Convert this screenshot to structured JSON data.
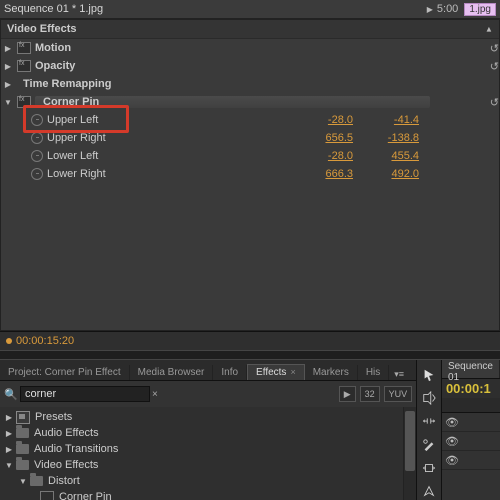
{
  "header": {
    "sequence_title": "Sequence 01 * 1.jpg",
    "duration": "5:00",
    "clip_tag": "1.jpg"
  },
  "fx": {
    "heading": "Video Effects",
    "motion": "Motion",
    "opacity": "Opacity",
    "time_remap": "Time Remapping",
    "corner_pin": "Corner Pin",
    "props": [
      {
        "name": "Upper Left",
        "x": "-28.0",
        "y": "-41.4"
      },
      {
        "name": "Upper Right",
        "x": "656.5",
        "y": "-138.8"
      },
      {
        "name": "Lower Left",
        "x": "-28.0",
        "y": "455.4"
      },
      {
        "name": "Lower Right",
        "x": "666.3",
        "y": "492.0"
      }
    ]
  },
  "current_time": "00:00:15:20",
  "project": {
    "tabs": [
      "Project: Corner Pin Effect",
      "Media Browser",
      "Info",
      "Effects",
      "Markers",
      "His"
    ],
    "active_tab": 3,
    "search_value": "corner",
    "type_badge_a": "32",
    "type_badge_b": "YUV",
    "tree": {
      "presets": "Presets",
      "audio_effects": "Audio Effects",
      "audio_transitions": "Audio Transitions",
      "video_effects": "Video Effects",
      "distort": "Distort",
      "corner_pin": "Corner Pin"
    }
  },
  "timeline": {
    "tab": "Sequence 01",
    "time": "00:00:1"
  }
}
